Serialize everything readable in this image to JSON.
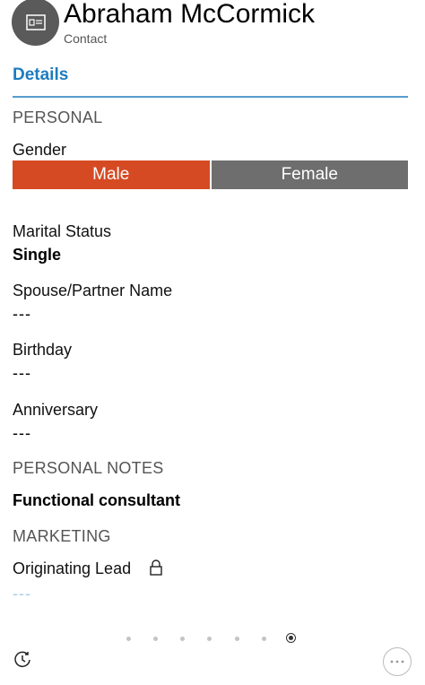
{
  "header": {
    "title": "Abraham McCormick",
    "subtitle": "Contact",
    "avatar_icon": "contact-card-icon"
  },
  "tabs": [
    {
      "label": "Details",
      "active": true
    }
  ],
  "personal": {
    "section_title": "PERSONAL",
    "gender": {
      "label": "Gender",
      "options": [
        "Male",
        "Female"
      ],
      "selected": "Male"
    },
    "marital_status": {
      "label": "Marital Status",
      "value": "Single"
    },
    "spouse": {
      "label": "Spouse/Partner Name",
      "value": "---"
    },
    "birthday": {
      "label": "Birthday",
      "value": "---"
    },
    "anniversary": {
      "label": "Anniversary",
      "value": "---"
    }
  },
  "personal_notes": {
    "section_title": "PERSONAL NOTES",
    "value": "Functional consultant"
  },
  "marketing": {
    "section_title": "MARKETING",
    "originating_lead": {
      "label": "Originating Lead",
      "value": "---",
      "locked": true
    }
  },
  "pager": {
    "count": 7,
    "active_index": 6
  },
  "colors": {
    "accent": "#1f7bbf",
    "selected": "#d64a23",
    "unselected": "#6e6e6e"
  },
  "icons": {
    "history": "history-icon",
    "more": "more-icon",
    "lock": "lock-icon"
  }
}
